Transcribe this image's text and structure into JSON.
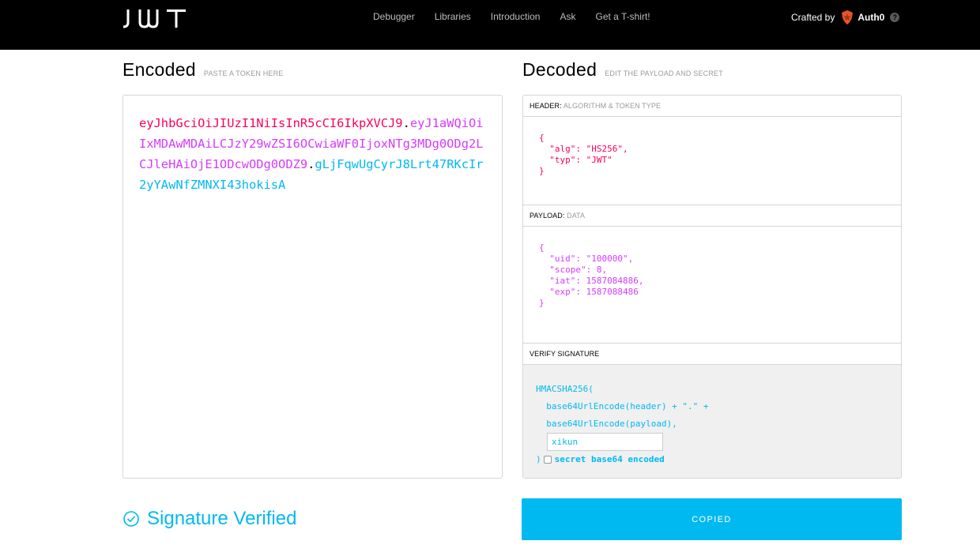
{
  "nav": {
    "logo_text": "JWT",
    "links": [
      "Debugger",
      "Libraries",
      "Introduction",
      "Ask",
      "Get a T-shirt!"
    ],
    "crafted_by": "Crafted by",
    "brand": "Auth0",
    "info_icon": "?"
  },
  "encoded": {
    "title": "Encoded",
    "subtitle": "PASTE A TOKEN HERE",
    "token_header": "eyJhbGciOiJIUzI1NiIsInR5cCI6IkpXVCJ9",
    "dot1": ".",
    "token_payload": "eyJ1aWQiOiIxMDAwMDAiLCJzY29wZSI6OCwiaWF0IjoxNTg3MDg0ODg2LCJleHAiOjE1ODcwODg0ODZ9",
    "dot2": ".",
    "token_signature": "gLjFqwUgCyrJ8Lrt47RKcIr2yYAwNfZMNXI43hokisA"
  },
  "decoded": {
    "title": "Decoded",
    "subtitle": "EDIT THE PAYLOAD AND SECRET",
    "header_label": "HEADER:",
    "header_sub": "ALGORITHM & TOKEN TYPE",
    "header_lines": [
      "{",
      "  \"alg\": \"HS256\",",
      "  \"typ\": \"JWT\"",
      "}"
    ],
    "payload_label": "PAYLOAD:",
    "payload_sub": "DATA",
    "payload_lines": [
      "{",
      "  \"uid\": \"100000\",",
      "  \"scope\": 8,",
      "  \"iat\": 1587084886,",
      "  \"exp\": 1587088486",
      "}"
    ],
    "verify_label": "VERIFY SIGNATURE",
    "sig_fn": "HMACSHA256(",
    "sig_line1": "  base64UrlEncode(header) + \".\" +",
    "sig_line2": "  base64UrlEncode(payload),",
    "secret_value": "xikun",
    "sig_close": ")",
    "base64_label": "secret base64 encoded"
  },
  "status": {
    "verified_text": "Signature Verified"
  },
  "copy_button": {
    "label": "COPIED"
  },
  "colors": {
    "header": "#fb015b",
    "payload": "#d63aff",
    "signature": "#00b9f1"
  }
}
